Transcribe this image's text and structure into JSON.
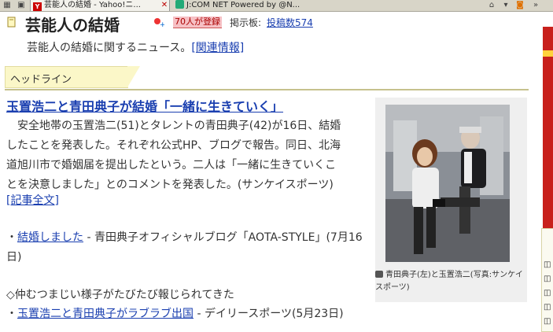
{
  "tabs": [
    {
      "label": "芸能人の結婚 - Yahoo!ニ...",
      "active": true
    },
    {
      "label": "J:COM NET Powered by @N...",
      "active": false
    }
  ],
  "header": {
    "title": "芸能人の結婚",
    "badge": "70人が登録",
    "board_label": "掲示板:",
    "board_link": "投稿数574",
    "description": "芸能人の結婚に関するニュース。",
    "related_link": "[関連情報]"
  },
  "headline": {
    "label": "ヘッドライン"
  },
  "article": {
    "title": "玉置浩二と青田典子が結婚「一緒に生きていく」",
    "body": "安全地帯の玉置浩二(51)とタレントの青田典子(42)が16日、結婚したことを発表した。それぞれ公式HP、ブログで報告。同日、北海道旭川市で婚姻届を提出したという。二人は「一緒に生きていくことを決意しました」とのコメントを発表した。(サンケイスポーツ)",
    "read_more": "[記事全文]"
  },
  "related": [
    {
      "bullet": "・",
      "link": "結婚しました",
      "rest": " - 青田典子オフィシャルブログ「AOTA-STYLE」(7月16日)"
    }
  ],
  "related_heading": "◇仲むつまじい様子がたびたび報じられてきた",
  "related2": {
    "bullet": "・",
    "link": "玉置浩二と青田典子がラブラブ出国",
    "rest": " - デイリースポーツ(5月23日)"
  },
  "photo": {
    "caption": "青田典子(左)と玉置浩二(写真:サンケイスポーツ)"
  },
  "colors": {
    "link": "#1a3fb0",
    "headline_tab": "#fbf7c8",
    "badge_bg": "#f6c0c4"
  }
}
